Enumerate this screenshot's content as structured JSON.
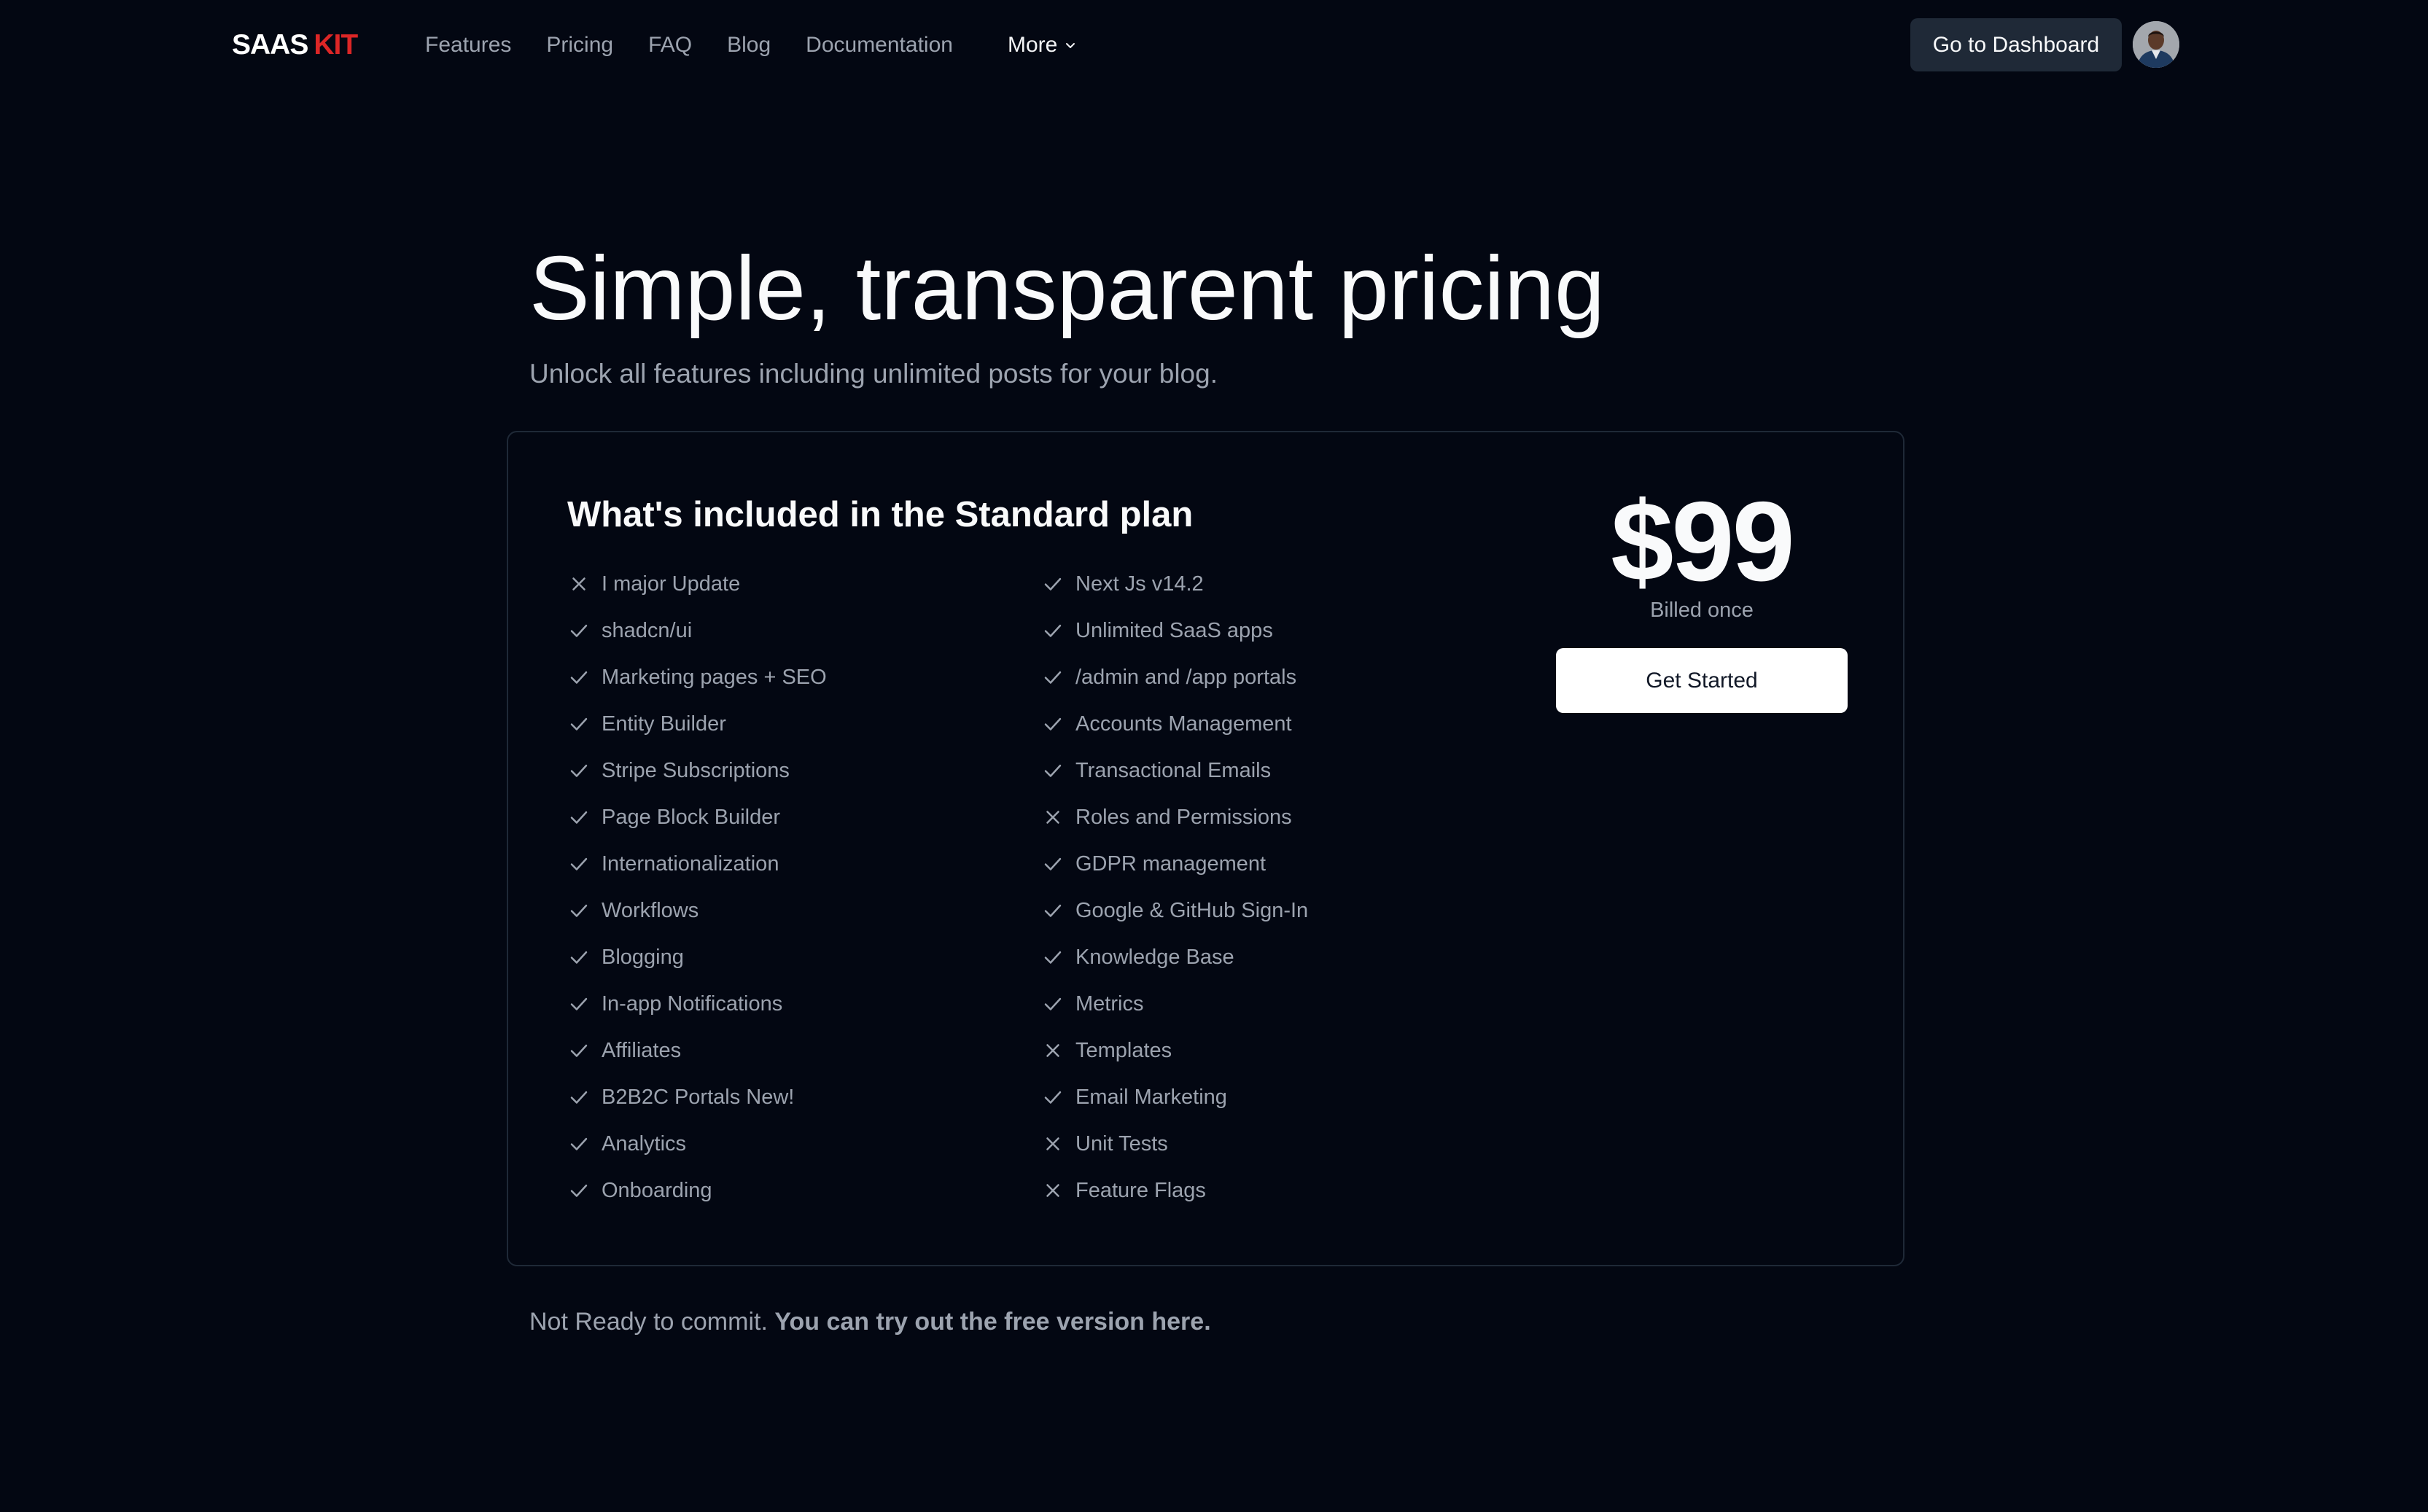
{
  "header": {
    "logo_part1": "SAAS",
    "logo_part2": "KIT",
    "nav": [
      "Features",
      "Pricing",
      "FAQ",
      "Blog",
      "Documentation"
    ],
    "more_label": "More",
    "dashboard_label": "Go to Dashboard"
  },
  "hero": {
    "title": "Simple, transparent pricing",
    "subtitle": "Unlock all features including unlimited posts for your blog."
  },
  "plan": {
    "title": "What's included in the Standard plan",
    "price": "$99",
    "billing": "Billed once",
    "cta_label": "Get Started",
    "features_left": [
      {
        "label": "I major Update",
        "included": false
      },
      {
        "label": "shadcn/ui",
        "included": true
      },
      {
        "label": "Marketing pages + SEO",
        "included": true
      },
      {
        "label": "Entity Builder",
        "included": true
      },
      {
        "label": "Stripe Subscriptions",
        "included": true
      },
      {
        "label": "Page Block Builder",
        "included": true
      },
      {
        "label": "Internationalization",
        "included": true
      },
      {
        "label": "Workflows",
        "included": true
      },
      {
        "label": "Blogging",
        "included": true
      },
      {
        "label": "In-app Notifications",
        "included": true
      },
      {
        "label": "Affiliates",
        "included": true
      },
      {
        "label": "B2B2C Portals New!",
        "included": true
      },
      {
        "label": "Analytics",
        "included": true
      },
      {
        "label": "Onboarding",
        "included": true
      }
    ],
    "features_right": [
      {
        "label": "Next Js v14.2",
        "included": true
      },
      {
        "label": "Unlimited SaaS apps",
        "included": true
      },
      {
        "label": "/admin and /app portals",
        "included": true
      },
      {
        "label": "Accounts Management",
        "included": true
      },
      {
        "label": "Transactional Emails",
        "included": true
      },
      {
        "label": "Roles and Permissions",
        "included": false
      },
      {
        "label": "GDPR management",
        "included": true
      },
      {
        "label": "Google & GitHub Sign-In",
        "included": true
      },
      {
        "label": "Knowledge Base",
        "included": true
      },
      {
        "label": "Metrics",
        "included": true
      },
      {
        "label": "Templates",
        "included": false
      },
      {
        "label": "Email Marketing",
        "included": true
      },
      {
        "label": "Unit Tests",
        "included": false
      },
      {
        "label": "Feature Flags",
        "included": false
      }
    ]
  },
  "footer_note": {
    "text": "Not Ready to commit.",
    "link_text": "You can try out the free version here."
  },
  "icons": {
    "included": "check-icon",
    "excluded": "x-icon",
    "more": "chevron-down-icon"
  },
  "colors": {
    "background": "#030712",
    "logo_accent": "#dc2626",
    "muted_text": "#9ca3af",
    "button_dark": "#1f2937"
  }
}
